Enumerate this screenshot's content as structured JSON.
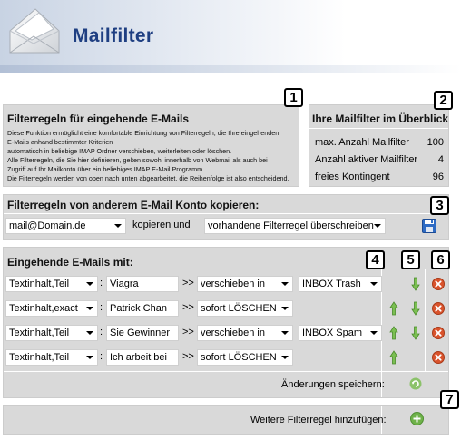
{
  "header": {
    "title": "Mailfilter",
    "logo_icon": "envelope-icon"
  },
  "markers": [
    "1",
    "2",
    "3",
    "4",
    "5",
    "6",
    "7"
  ],
  "intro": {
    "heading": "Filterregeln für eingehende E-Mails",
    "lines": [
      "Diese Funktion ermöglicht eine komfortable Einrichtung von Filterregeln, die Ihre eingehenden",
      "E-Mails anhand bestimmter Kriterien",
      "automatisch in beliebige IMAP Ordner verschieben, weiterleiten oder löschen.",
      "Alle Filterregeln, die Sie hier definieren, gelten sowohl innerhalb von Webmail als auch bei",
      "Zugriff auf Ihr Mailkonto über ein beliebiges IMAP E-Mail Programm.",
      "Die Filterregeln werden von oben nach unten abgearbeitet, die Reihenfolge ist also entscheidend."
    ]
  },
  "overview": {
    "heading": "Ihre Mailfilter im Überblick",
    "stats": [
      {
        "label": "max. Anzahl Mailfilter",
        "value": "100"
      },
      {
        "label": "Anzahl aktiver Mailfilter",
        "value": "4"
      },
      {
        "label": "freies Kontingent",
        "value": "96"
      }
    ]
  },
  "copy": {
    "heading": "Filterregeln von anderem E-Mail Konto kopieren:",
    "account": "mail@Domain.de",
    "middle_label": "kopieren und",
    "mode": "vorhandene Filterregel überschreiben",
    "save_icon": "floppy-disk-icon"
  },
  "incoming": {
    "heading": "Eingehende E-Mails mit:",
    "arrow_sep": ">>",
    "colon_sep": ":",
    "rules": [
      {
        "field": "Textinhalt,Teil",
        "value": "Viagra",
        "action": "verschieben in",
        "folder": "INBOX Trash",
        "up": false,
        "down": true
      },
      {
        "field": "Textinhalt,exact",
        "value": "Patrick Chan",
        "action": "sofort LÖSCHEN",
        "folder": "",
        "up": true,
        "down": true
      },
      {
        "field": "Textinhalt,Teil",
        "value": "Sie Gewinner",
        "action": "verschieben in",
        "folder": "INBOX Spam",
        "up": true,
        "down": true
      },
      {
        "field": "Textinhalt,Teil",
        "value": "Ich arbeit bei",
        "action": "sofort LÖSCHEN",
        "folder": "",
        "up": true,
        "down": false
      }
    ],
    "save_label": "Änderungen speichern:",
    "add_label": "Weitere Filterregel hinzufügen:"
  },
  "colors": {
    "title": "#1f3f82",
    "panel": "#d9d9d9",
    "arrow_green": "#5aa03c",
    "delete_red": "#d24a24"
  }
}
